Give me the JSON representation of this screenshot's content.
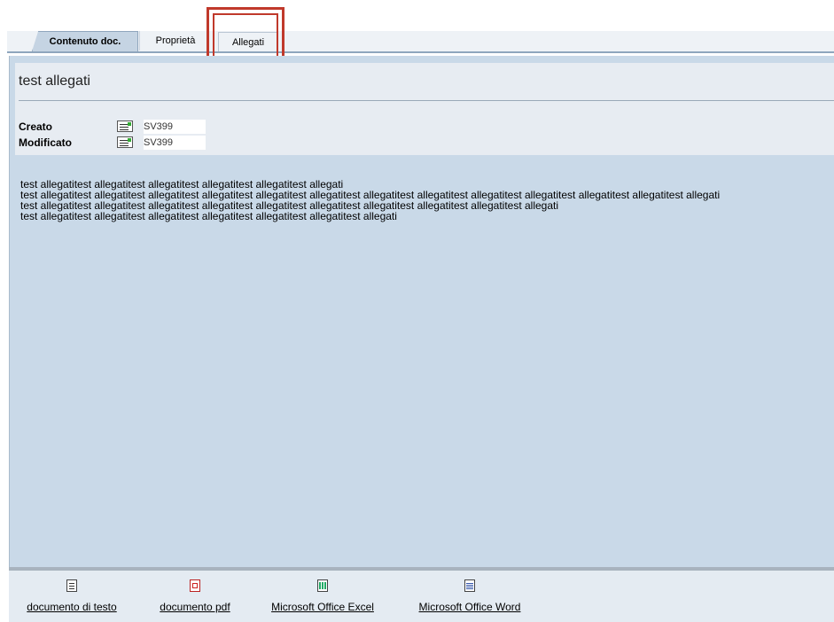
{
  "tabs": {
    "content": "Contenuto doc.",
    "properties": "Proprietà",
    "attachments": "Allegati"
  },
  "document": {
    "title": "test allegati",
    "created_label": "Creato",
    "created_value": "SV399",
    "modified_label": "Modificato",
    "modified_value": "SV399"
  },
  "body_lines": [
    "test allegatitest allegatitest allegatitest allegatitest allegatitest allegati",
    "test allegatitest allegatitest allegatitest allegatitest allegatitest allegatitest allegatitest allegatitest allegatitest allegatitest allegatitest allegatitest allegati",
    "test allegatitest allegatitest allegatitest allegatitest allegatitest allegatitest allegatitest allegatitest allegatitest allegati",
    "test allegatitest allegatitest allegatitest allegatitest allegatitest allegatitest allegati"
  ],
  "attachments": [
    {
      "label": "documento di testo",
      "icon": "text-document-icon"
    },
    {
      "label": "documento pdf",
      "icon": "pdf-icon"
    },
    {
      "label": "Microsoft Office Excel",
      "icon": "excel-icon"
    },
    {
      "label": "Microsoft Office Word",
      "icon": "word-icon"
    }
  ],
  "colors": {
    "highlight": "#c0392b",
    "panel": "#c9d9e8",
    "tab_active": "#c5d4e3"
  }
}
